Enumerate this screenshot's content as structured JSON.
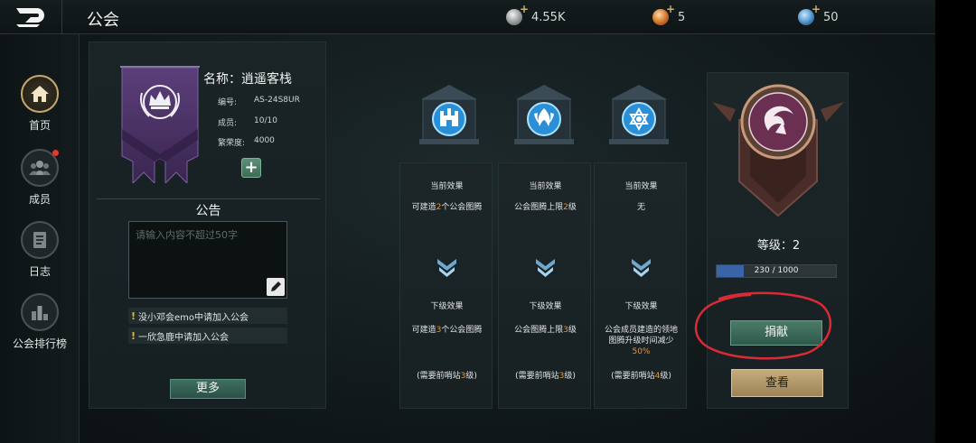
{
  "header": {
    "title": "公会",
    "resources": [
      {
        "icon": "silver-coin-icon",
        "value": "4.55K"
      },
      {
        "icon": "gold-medal-icon",
        "value": "5"
      },
      {
        "icon": "blue-gem-icon",
        "value": "50"
      }
    ]
  },
  "sidebar": {
    "items": [
      {
        "label": "首页",
        "icon": "home-icon",
        "active": true
      },
      {
        "label": "成员",
        "icon": "members-icon",
        "badge": true
      },
      {
        "label": "日志",
        "icon": "log-icon"
      },
      {
        "label": "公会排行榜",
        "icon": "ranking-icon"
      }
    ]
  },
  "guild": {
    "name": "名称：逍遥客栈",
    "id_label": "编号:",
    "id_value": "AS-24S8UR",
    "members_label": "成员:",
    "members_value": "10/10",
    "prosperity_label": "繁荣度:",
    "prosperity_value": "4000",
    "notice_title": "公告",
    "notice_placeholder": "请输入内容不超过50字",
    "messages": [
      "没小邓会emo中请加入公会",
      "一欣急鹿中请加入公会"
    ],
    "more_label": "更多"
  },
  "totems": [
    {
      "current_label": "当前效果",
      "current_pre": "可建造",
      "current_hl": "2",
      "current_post": "个公会图腾",
      "next_label": "下级效果",
      "next_pre": "可建造",
      "next_hl": "3",
      "next_post": "个公会图腾",
      "req_pre": "(需要前哨站",
      "req_hl": "3",
      "req_post": "级)"
    },
    {
      "current_label": "当前效果",
      "current_pre": "公会图腾上限",
      "current_hl": "2",
      "current_post": "级",
      "next_label": "下级效果",
      "next_pre": "公会图腾上限",
      "next_hl": "3",
      "next_post": "级",
      "req_pre": "(需要前哨站",
      "req_hl": "3",
      "req_post": "级)"
    },
    {
      "current_label": "当前效果",
      "current_pre": "无",
      "current_hl": "",
      "current_post": "",
      "next_label": "下级效果",
      "next_line1": "公会成员建造的领地",
      "next_line2": "图腾升级时间减少",
      "next_line3": "50%",
      "req_pre": "(需要前哨站",
      "req_hl": "4",
      "req_post": "级)"
    }
  ],
  "level": {
    "label": "等级：2",
    "xp_current": 230,
    "xp_max": 1000,
    "xp_text": "230 / 1000",
    "donate_label": "捐献",
    "view_label": "查看"
  },
  "colors": {
    "accent_green": "#3f6f60",
    "accent_gold": "#c7ad7b",
    "highlight_orange": "#e8963b",
    "xp_blue": "#3a64a8",
    "annotation_red": "#d92b35"
  }
}
